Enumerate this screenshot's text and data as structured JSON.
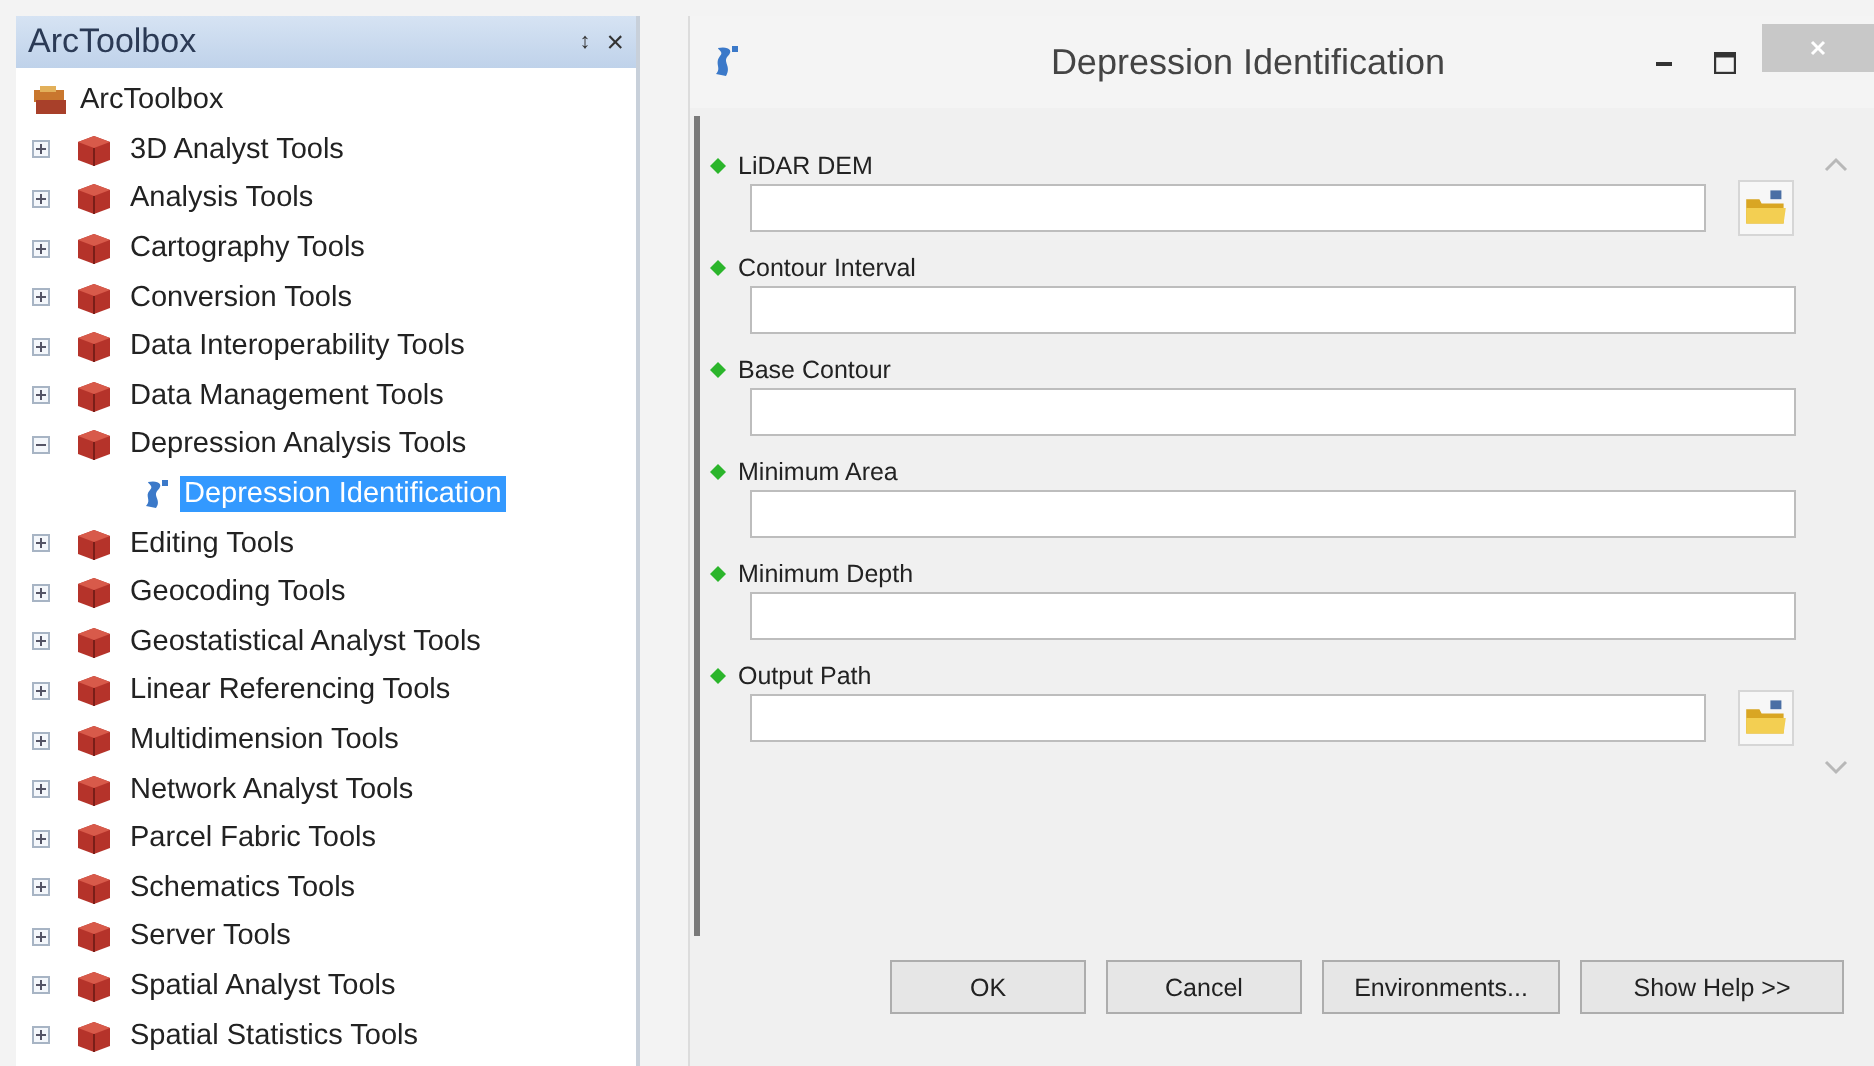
{
  "toolbox_panel": {
    "title": "ArcToolbox",
    "pin": "↕",
    "close": "×"
  },
  "tree": {
    "label": "ArcToolbox",
    "kind": "root",
    "children": [
      {
        "label": "3D Analyst Tools",
        "kind": "toolbox",
        "expanded": false,
        "selected": false
      },
      {
        "label": "Analysis Tools",
        "kind": "toolbox",
        "expanded": false,
        "selected": false
      },
      {
        "label": "Cartography Tools",
        "kind": "toolbox",
        "expanded": false,
        "selected": false
      },
      {
        "label": "Conversion Tools",
        "kind": "toolbox",
        "expanded": false,
        "selected": false
      },
      {
        "label": "Data Interoperability Tools",
        "kind": "toolbox",
        "expanded": false,
        "selected": false
      },
      {
        "label": "Data Management Tools",
        "kind": "toolbox",
        "expanded": false,
        "selected": false
      },
      {
        "label": "Depression Analysis Tools",
        "kind": "toolbox",
        "expanded": true,
        "selected": false,
        "children": [
          {
            "label": "Depression Identification",
            "kind": "tool",
            "selected": true
          }
        ]
      },
      {
        "label": "Editing Tools",
        "kind": "toolbox",
        "expanded": false,
        "selected": false
      },
      {
        "label": "Geocoding Tools",
        "kind": "toolbox",
        "expanded": false,
        "selected": false
      },
      {
        "label": "Geostatistical Analyst Tools",
        "kind": "toolbox",
        "expanded": false,
        "selected": false
      },
      {
        "label": "Linear Referencing Tools",
        "kind": "toolbox",
        "expanded": false,
        "selected": false
      },
      {
        "label": "Multidimension Tools",
        "kind": "toolbox",
        "expanded": false,
        "selected": false
      },
      {
        "label": "Network Analyst Tools",
        "kind": "toolbox",
        "expanded": false,
        "selected": false
      },
      {
        "label": "Parcel Fabric Tools",
        "kind": "toolbox",
        "expanded": false,
        "selected": false
      },
      {
        "label": "Schematics Tools",
        "kind": "toolbox",
        "expanded": false,
        "selected": false
      },
      {
        "label": "Server Tools",
        "kind": "toolbox",
        "expanded": false,
        "selected": false
      },
      {
        "label": "Spatial Analyst Tools",
        "kind": "toolbox",
        "expanded": false,
        "selected": false
      },
      {
        "label": "Spatial Statistics Tools",
        "kind": "toolbox",
        "expanded": false,
        "selected": false
      }
    ]
  },
  "dialog": {
    "title": "Depression Identification",
    "fields": [
      {
        "label": "LiDAR DEM",
        "browse": true
      },
      {
        "label": "Contour Interval",
        "browse": false
      },
      {
        "label": "Base Contour",
        "browse": false
      },
      {
        "label": "Minimum Area",
        "browse": false
      },
      {
        "label": "Minimum Depth",
        "browse": false
      },
      {
        "label": "Output Path",
        "browse": true
      }
    ],
    "buttons": [
      "OK",
      "Cancel",
      "Environments...",
      "Show Help >>"
    ]
  }
}
